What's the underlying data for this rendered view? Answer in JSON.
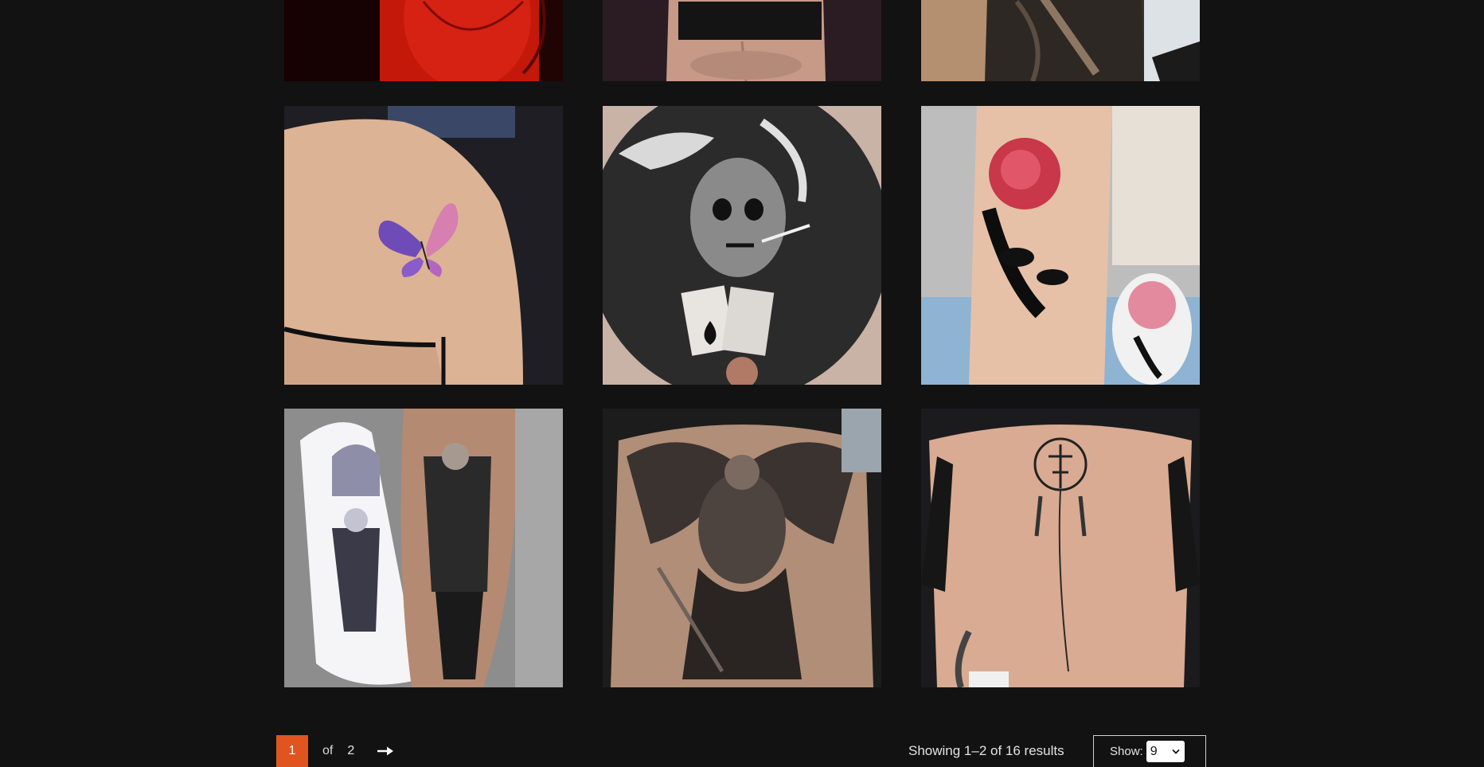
{
  "gallery": {
    "tiles": [
      {
        "name": "tattoo-red-torso",
        "alt": ""
      },
      {
        "name": "tattoo-back-waist",
        "alt": ""
      },
      {
        "name": "tattoo-sleeve-arm",
        "alt": ""
      },
      {
        "name": "tattoo-butterfly-shoulder",
        "alt": ""
      },
      {
        "name": "tattoo-skull-chest",
        "alt": ""
      },
      {
        "name": "tattoo-rose-leg",
        "alt": ""
      },
      {
        "name": "tattoo-viking-leg",
        "alt": ""
      },
      {
        "name": "tattoo-angel-back",
        "alt": ""
      },
      {
        "name": "tattoo-dreamcatcher-spine",
        "alt": ""
      }
    ]
  },
  "pagination": {
    "current_page": "1",
    "of_label": "of",
    "total_pages": "2",
    "next_icon": "arrow-right-icon"
  },
  "results": {
    "text": "Showing 1–2 of 16 results"
  },
  "show": {
    "label": "Show:",
    "selected": "9",
    "dropdown_icon": "chevron-down-icon"
  },
  "colors": {
    "background": "#121212",
    "accent": "#e0541f"
  }
}
